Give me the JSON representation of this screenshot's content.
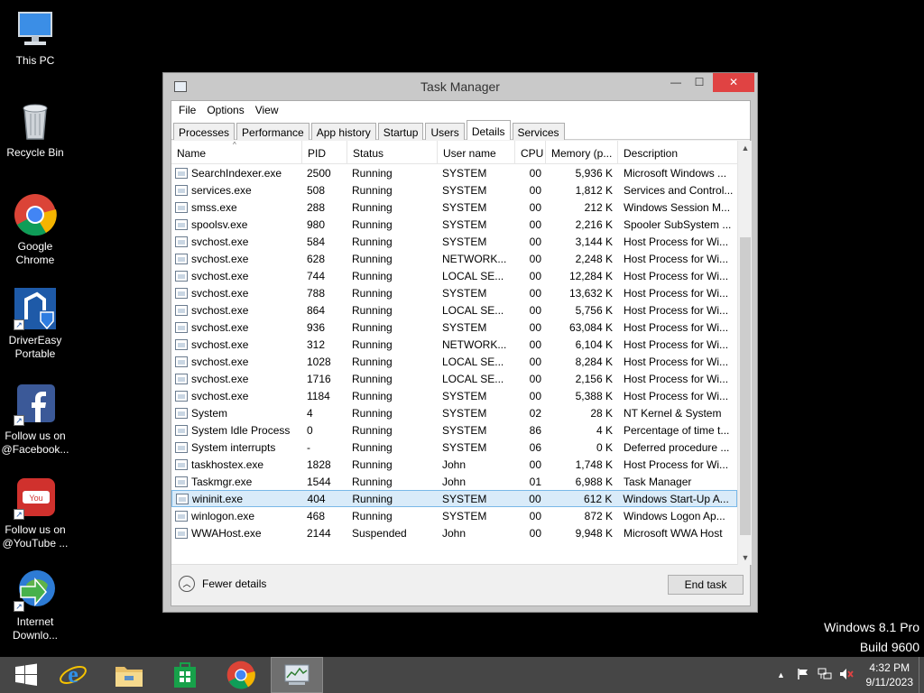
{
  "desktop": {
    "icons": [
      {
        "label": "This PC",
        "icon": "computer-icon"
      },
      {
        "label": "Recycle Bin",
        "icon": "recycle-bin-icon"
      },
      {
        "label": "Google Chrome",
        "icon": "chrome-icon"
      },
      {
        "label": "DriverEasy Portable",
        "icon": "drivereasy-icon"
      },
      {
        "label": "Follow us on @Facebook...",
        "icon": "facebook-icon"
      },
      {
        "label": "Follow us on @YouTube ...",
        "icon": "youtube-icon"
      },
      {
        "label": "Internet Downlo...",
        "icon": "internet-download-manager-icon"
      }
    ],
    "watermark": {
      "line1": "Windows 8.1 Pro",
      "line2": "Build 9600"
    }
  },
  "window": {
    "title": "Task Manager",
    "min_glyph": "—",
    "max_glyph": "☐",
    "close_glyph": "✕",
    "menu": [
      "File",
      "Options",
      "View"
    ],
    "tabs": [
      "Processes",
      "Performance",
      "App history",
      "Startup",
      "Users",
      "Details",
      "Services"
    ],
    "active_tab": "Details",
    "columns": {
      "name": "Name",
      "pid": "PID",
      "status": "Status",
      "user": "User name",
      "cpu": "CPU",
      "memory": "Memory (p...",
      "description": "Description"
    },
    "sort_glyph": "^",
    "rows": [
      {
        "name": "SearchIndexer.exe",
        "pid": "2500",
        "status": "Running",
        "user": "SYSTEM",
        "cpu": "00",
        "mem": "5,936 K",
        "desc": "Microsoft Windows ..."
      },
      {
        "name": "services.exe",
        "pid": "508",
        "status": "Running",
        "user": "SYSTEM",
        "cpu": "00",
        "mem": "1,812 K",
        "desc": "Services and Control..."
      },
      {
        "name": "smss.exe",
        "pid": "288",
        "status": "Running",
        "user": "SYSTEM",
        "cpu": "00",
        "mem": "212 K",
        "desc": "Windows Session M..."
      },
      {
        "name": "spoolsv.exe",
        "pid": "980",
        "status": "Running",
        "user": "SYSTEM",
        "cpu": "00",
        "mem": "2,216 K",
        "desc": "Spooler SubSystem ..."
      },
      {
        "name": "svchost.exe",
        "pid": "584",
        "status": "Running",
        "user": "SYSTEM",
        "cpu": "00",
        "mem": "3,144 K",
        "desc": "Host Process for Wi..."
      },
      {
        "name": "svchost.exe",
        "pid": "628",
        "status": "Running",
        "user": "NETWORK...",
        "cpu": "00",
        "mem": "2,248 K",
        "desc": "Host Process for Wi..."
      },
      {
        "name": "svchost.exe",
        "pid": "744",
        "status": "Running",
        "user": "LOCAL SE...",
        "cpu": "00",
        "mem": "12,284 K",
        "desc": "Host Process for Wi..."
      },
      {
        "name": "svchost.exe",
        "pid": "788",
        "status": "Running",
        "user": "SYSTEM",
        "cpu": "00",
        "mem": "13,632 K",
        "desc": "Host Process for Wi..."
      },
      {
        "name": "svchost.exe",
        "pid": "864",
        "status": "Running",
        "user": "LOCAL SE...",
        "cpu": "00",
        "mem": "5,756 K",
        "desc": "Host Process for Wi..."
      },
      {
        "name": "svchost.exe",
        "pid": "936",
        "status": "Running",
        "user": "SYSTEM",
        "cpu": "00",
        "mem": "63,084 K",
        "desc": "Host Process for Wi..."
      },
      {
        "name": "svchost.exe",
        "pid": "312",
        "status": "Running",
        "user": "NETWORK...",
        "cpu": "00",
        "mem": "6,104 K",
        "desc": "Host Process for Wi..."
      },
      {
        "name": "svchost.exe",
        "pid": "1028",
        "status": "Running",
        "user": "LOCAL SE...",
        "cpu": "00",
        "mem": "8,284 K",
        "desc": "Host Process for Wi..."
      },
      {
        "name": "svchost.exe",
        "pid": "1716",
        "status": "Running",
        "user": "LOCAL SE...",
        "cpu": "00",
        "mem": "2,156 K",
        "desc": "Host Process for Wi..."
      },
      {
        "name": "svchost.exe",
        "pid": "1184",
        "status": "Running",
        "user": "SYSTEM",
        "cpu": "00",
        "mem": "5,388 K",
        "desc": "Host Process for Wi..."
      },
      {
        "name": "System",
        "pid": "4",
        "status": "Running",
        "user": "SYSTEM",
        "cpu": "02",
        "mem": "28 K",
        "desc": "NT Kernel & System"
      },
      {
        "name": "System Idle Process",
        "pid": "0",
        "status": "Running",
        "user": "SYSTEM",
        "cpu": "86",
        "mem": "4 K",
        "desc": "Percentage of time t..."
      },
      {
        "name": "System interrupts",
        "pid": "-",
        "status": "Running",
        "user": "SYSTEM",
        "cpu": "06",
        "mem": "0 K",
        "desc": "Deferred procedure ..."
      },
      {
        "name": "taskhostex.exe",
        "pid": "1828",
        "status": "Running",
        "user": "John",
        "cpu": "00",
        "mem": "1,748 K",
        "desc": "Host Process for Wi..."
      },
      {
        "name": "Taskmgr.exe",
        "pid": "1544",
        "status": "Running",
        "user": "John",
        "cpu": "01",
        "mem": "6,988 K",
        "desc": "Task Manager"
      },
      {
        "name": "wininit.exe",
        "pid": "404",
        "status": "Running",
        "user": "SYSTEM",
        "cpu": "00",
        "mem": "612 K",
        "desc": "Windows Start-Up A..."
      },
      {
        "name": "winlogon.exe",
        "pid": "468",
        "status": "Running",
        "user": "SYSTEM",
        "cpu": "00",
        "mem": "872 K",
        "desc": "Windows Logon Ap..."
      },
      {
        "name": "WWAHost.exe",
        "pid": "2144",
        "status": "Suspended",
        "user": "John",
        "cpu": "00",
        "mem": "9,948 K",
        "desc": "Microsoft WWA Host"
      }
    ],
    "selected_row": "wininit.exe",
    "scroll_up_glyph": "▲",
    "scroll_down_glyph": "▼",
    "fewer_details": "Fewer details",
    "fewer_glyph": "︿",
    "end_task": "End task"
  },
  "taskbar": {
    "items": [
      "start-icon",
      "internet-explorer-icon",
      "file-explorer-icon",
      "store-icon",
      "chrome-icon",
      "task-manager-icon"
    ],
    "active": "task-manager-icon",
    "tray": {
      "chevron": "▲",
      "time": "4:32 PM",
      "date": "9/11/2023"
    }
  },
  "colors": {
    "close_button": "#e04343",
    "selection": "#d9ebf9",
    "taskbar": "#464646"
  }
}
